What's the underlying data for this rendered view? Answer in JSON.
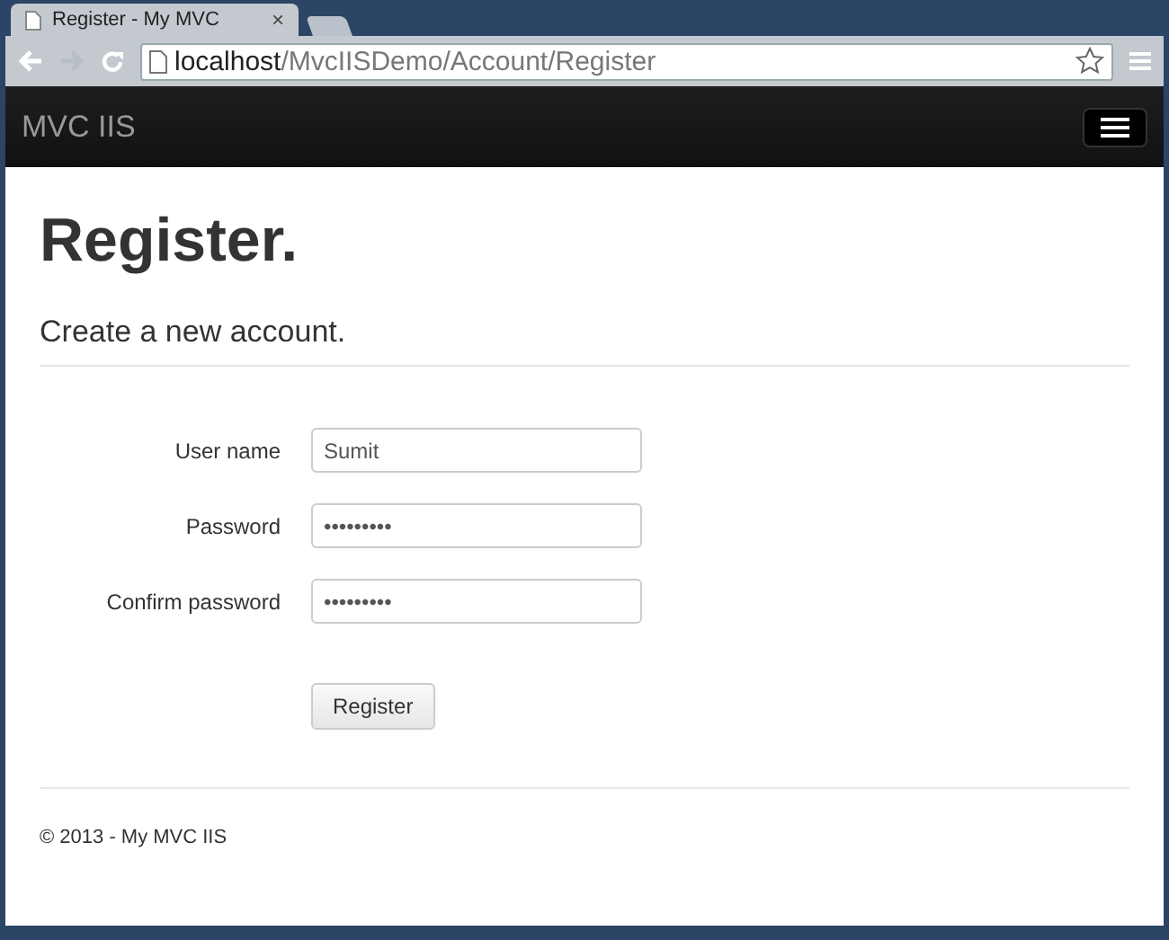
{
  "browser": {
    "tab_title": "Register - My MVC",
    "tab_close": "×",
    "url_host": "localhost",
    "url_path": "/MvcIISDemo/Account/Register"
  },
  "navbar": {
    "brand": "MVC IIS"
  },
  "page": {
    "title": "Register.",
    "subtitle": "Create a new account."
  },
  "form": {
    "fields": [
      {
        "label": "User name",
        "value": "Sumit"
      },
      {
        "label": "Password",
        "value": "•••••••••"
      },
      {
        "label": "Confirm password",
        "value": "•••••••••"
      }
    ],
    "submit": "Register"
  },
  "footer": "© 2013 - My MVC IIS"
}
